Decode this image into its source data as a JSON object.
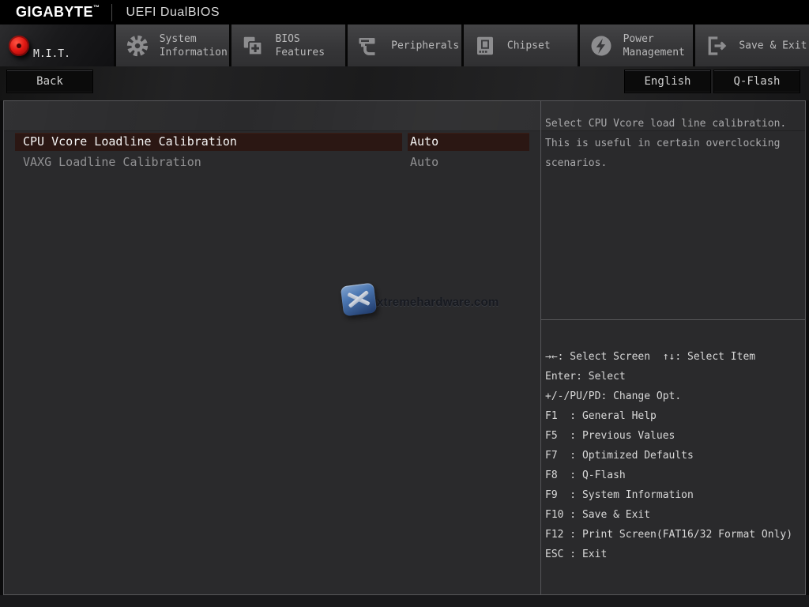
{
  "header": {
    "brand": "GIGABYTE",
    "trademark": "™",
    "title": "UEFI DualBIOS"
  },
  "tabs": [
    {
      "label": "M.I.T.",
      "active": true,
      "icon": "red-disc-icon"
    },
    {
      "line1": "System",
      "line2": "Information",
      "icon": "gear-icon"
    },
    {
      "line1": "BIOS",
      "line2": "Features",
      "icon": "bios-pages-icon"
    },
    {
      "label": "Peripherals",
      "icon": "peripheral-device-icon"
    },
    {
      "label": "Chipset",
      "icon": "chip-icon"
    },
    {
      "line1": "Power",
      "line2": "Management",
      "icon": "power-bolt-icon"
    },
    {
      "label": "Save & Exit",
      "icon": "exit-door-icon"
    }
  ],
  "toolbar": {
    "back": "Back",
    "language": "English",
    "qflash": "Q-Flash"
  },
  "settings": {
    "rows": [
      {
        "label": "CPU Vcore Loadline Calibration",
        "value": "Auto",
        "selected": true
      },
      {
        "label": "VAXG Loadline Calibration",
        "value": "Auto",
        "selected": false
      }
    ]
  },
  "help": {
    "text": "Select CPU Vcore load line calibration. This is useful in certain overclocking scenarios."
  },
  "keys": [
    "→←: Select Screen  ↑↓: Select Item",
    "Enter: Select",
    "+/-/PU/PD: Change Opt.",
    "F1  : General Help",
    "F5  : Previous Values",
    "F7  : Optimized Defaults",
    "F8  : Q-Flash",
    "F9  : System Information",
    "F10 : Save & Exit",
    "F12 : Print Screen(FAT16/32 Format Only)",
    "ESC : Exit"
  ],
  "watermark": {
    "text": "xtremehardware.com"
  },
  "colors": {
    "accent_red": "#d41212",
    "row_highlight": "#2b1713",
    "panel_bg": "#2a2a2c"
  }
}
